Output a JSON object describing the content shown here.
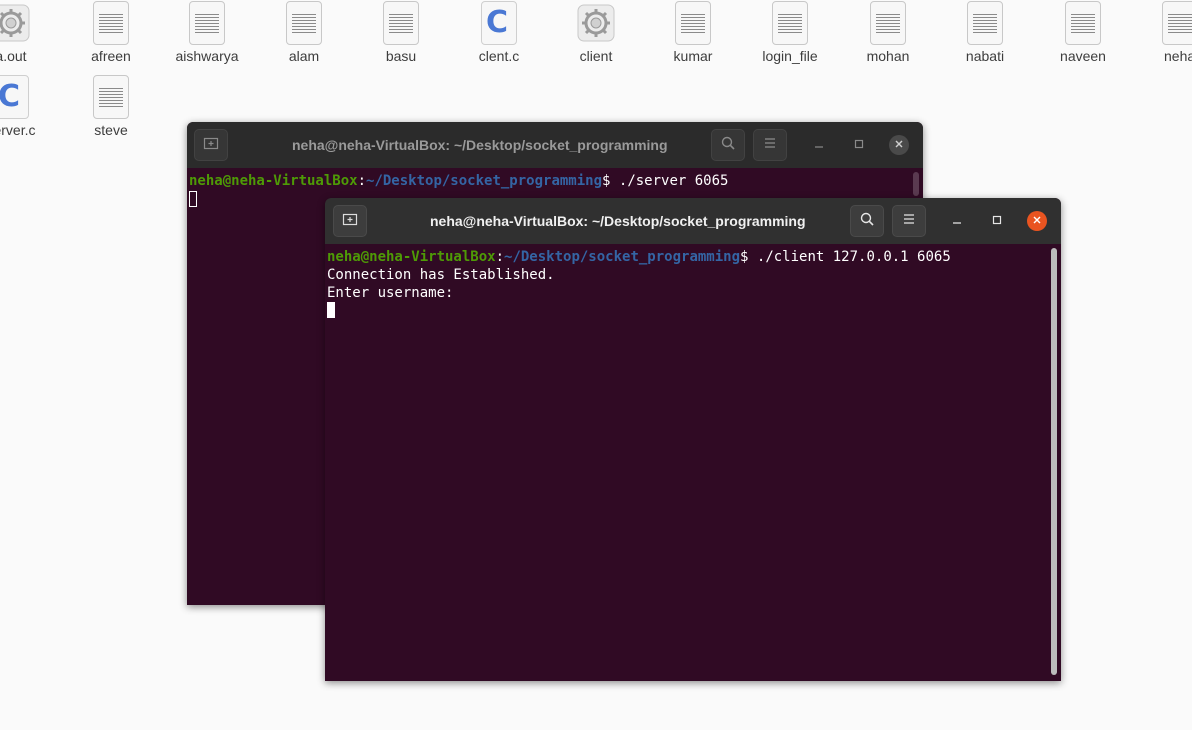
{
  "desktop": {
    "icons": [
      {
        "label": "a.out",
        "type": "executable"
      },
      {
        "label": "afreen",
        "type": "text-file"
      },
      {
        "label": "aishwarya",
        "type": "text-file"
      },
      {
        "label": "alam",
        "type": "text-file"
      },
      {
        "label": "basu",
        "type": "text-file"
      },
      {
        "label": "clent.c",
        "type": "c-source"
      },
      {
        "label": "client",
        "type": "executable"
      },
      {
        "label": "kumar",
        "type": "text-file"
      },
      {
        "label": "login_file",
        "type": "text-file"
      },
      {
        "label": "mohan",
        "type": "text-file"
      },
      {
        "label": "nabati",
        "type": "text-file"
      },
      {
        "label": "naveen",
        "type": "text-file"
      },
      {
        "label": "neha",
        "type": "text-file"
      },
      {
        "label": "server.c",
        "type": "c-source"
      },
      {
        "label": "steve",
        "type": "text-file"
      }
    ],
    "c_glyph": "C"
  },
  "server_terminal": {
    "title": "neha@neha-VirtualBox: ~/Desktop/socket_programming",
    "prompt_user": "neha@neha-VirtualBox",
    "prompt_colon": ":",
    "prompt_path": "~/Desktop/socket_programming",
    "prompt_dollar": "$ ",
    "command": "./server 6065"
  },
  "client_terminal": {
    "title": "neha@neha-VirtualBox: ~/Desktop/socket_programming",
    "prompt_user": "neha@neha-VirtualBox",
    "prompt_colon": ":",
    "prompt_path": "~/Desktop/socket_programming",
    "prompt_dollar": "$ ",
    "command": "./client 127.0.0.1 6065",
    "output": [
      "Connection has Established.",
      "Enter username:"
    ]
  },
  "colors": {
    "terminal_bg": "#300a24",
    "prompt_user": "#4e9a06",
    "prompt_path": "#3465a4",
    "close_active": "#e95420"
  },
  "icons": {
    "new_tab": "new-tab-icon",
    "search": "search-icon",
    "menu": "hamburger-menu-icon",
    "minimize": "minimize-icon",
    "maximize": "maximize-icon",
    "close": "close-icon"
  }
}
